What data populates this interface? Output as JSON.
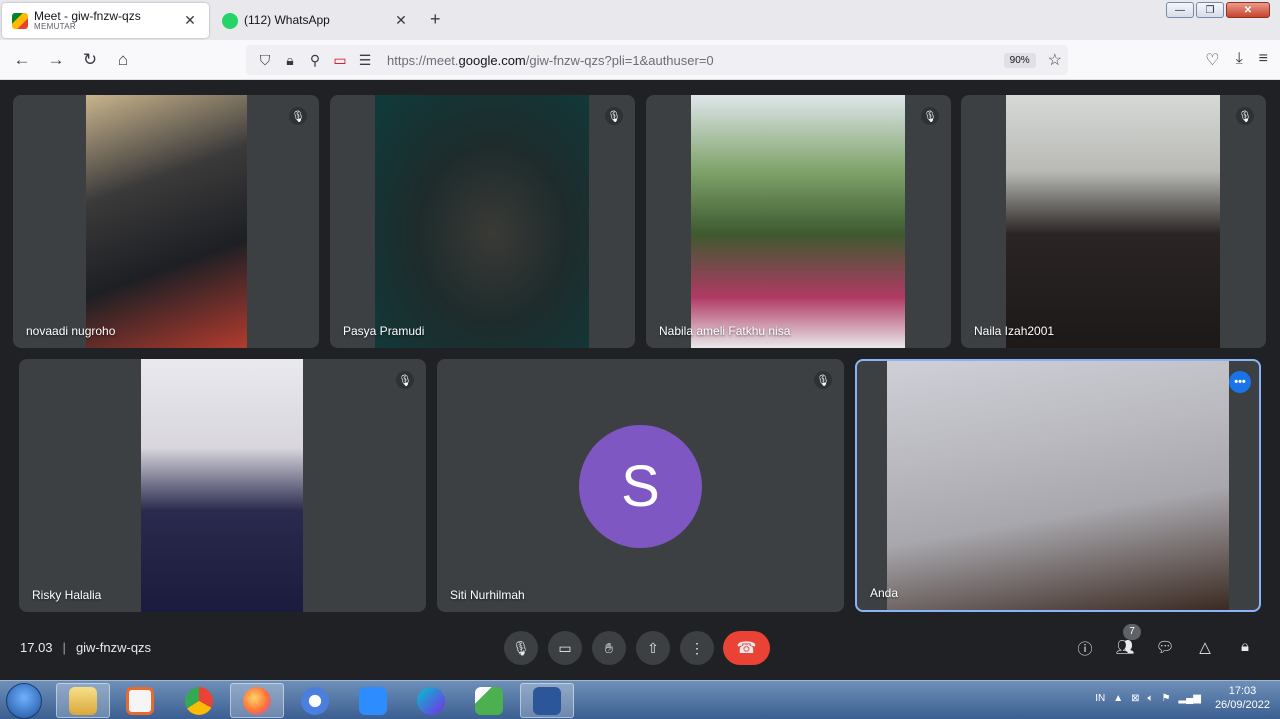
{
  "browser": {
    "tabs": [
      {
        "title": "Meet - giw-fnzw-qzs",
        "subtitle": "MEMUTAR"
      },
      {
        "title": "(112) WhatsApp"
      }
    ],
    "url_prefix": "https://meet.",
    "url_domain": "google.com",
    "url_path": "/giw-fnzw-qzs?pli=1&authuser=0",
    "zoom": "90%"
  },
  "participants": [
    {
      "name": "novaadi nugroho",
      "muted": true
    },
    {
      "name": "Pasya Pramudi",
      "muted": true
    },
    {
      "name": "Nabila ameli Fatkhu nisa",
      "muted": true
    },
    {
      "name": "Naila Izah2001",
      "muted": true
    },
    {
      "name": "Risky Halalia",
      "muted": true
    },
    {
      "name": "Siti Nurhilmah",
      "muted": true,
      "avatar_letter": "S",
      "avatar_color": "#7e57c2"
    },
    {
      "name": "Anda",
      "self": true
    }
  ],
  "meeting": {
    "time": "17.03",
    "separator": "|",
    "code": "giw-fnzw-qzs",
    "participant_count": "7"
  },
  "taskbar": {
    "language": "IN",
    "time": "17:03",
    "date": "26/09/2022"
  },
  "colors": {
    "meet_bg": "#202124",
    "tile_bg": "#3c4043",
    "hangup": "#ea4335",
    "self_border": "#8ab4f8"
  }
}
